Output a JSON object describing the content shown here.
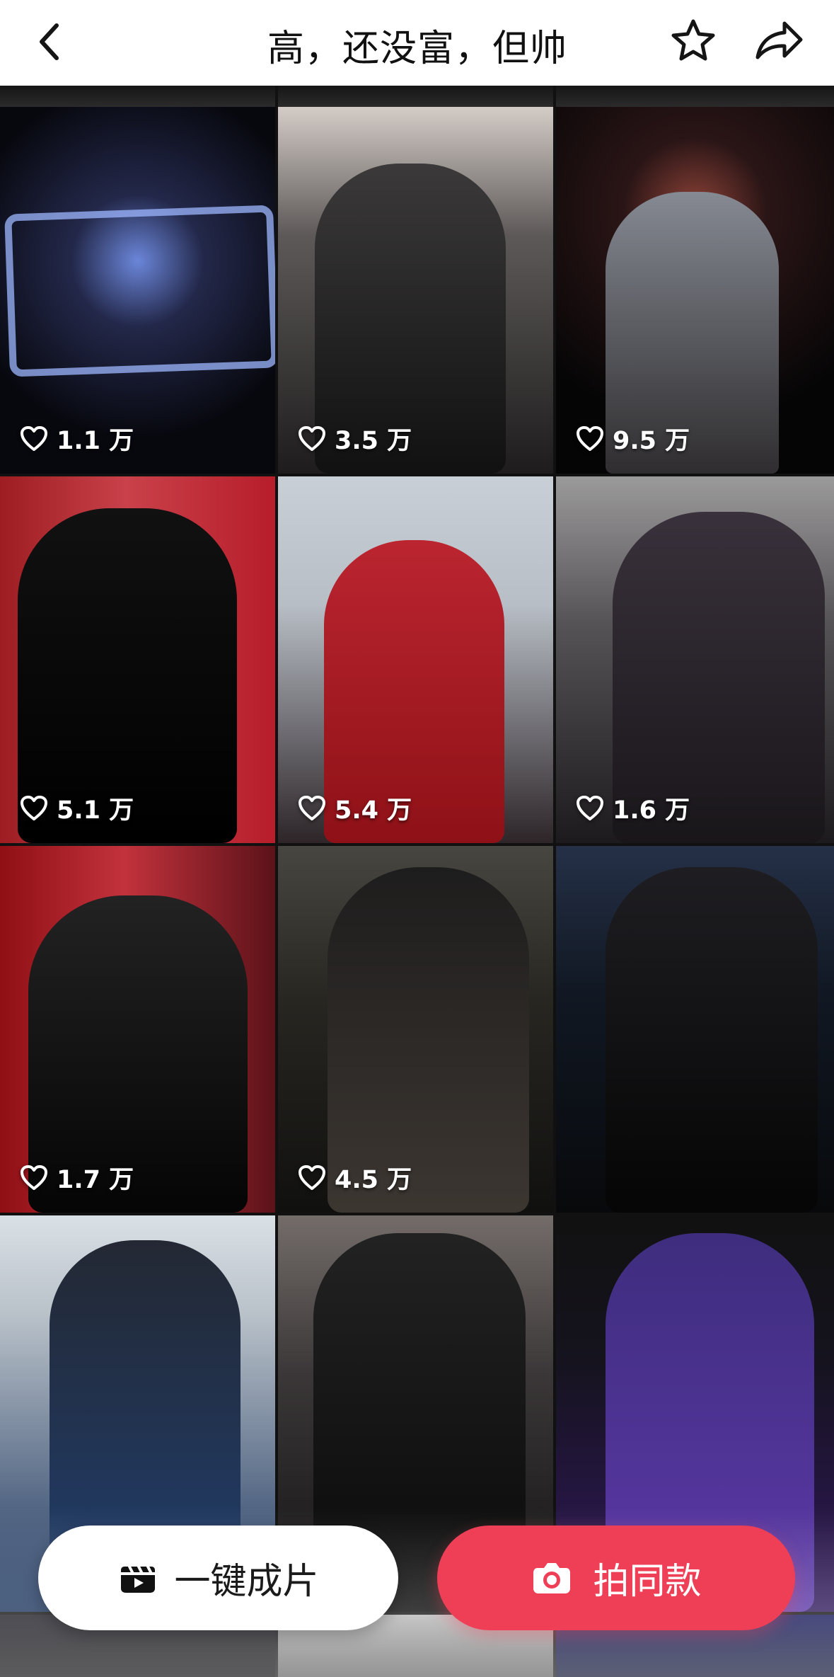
{
  "header": {
    "title": "高，还没富，但帅",
    "back_icon": "chevron-left-icon",
    "favorite_icon": "star-outline-icon",
    "share_icon": "share-arrow-icon"
  },
  "grid": {
    "tiles": [
      {
        "likes": "1.1 万"
      },
      {
        "likes": "3.5 万"
      },
      {
        "likes": "9.5 万"
      },
      {
        "likes": "5.1 万"
      },
      {
        "likes": "5.4 万"
      },
      {
        "likes": "1.6 万"
      },
      {
        "likes": "1.7 万"
      },
      {
        "likes": "4.5 万"
      },
      {
        "likes": ""
      },
      {
        "likes": ""
      },
      {
        "likes": ""
      },
      {
        "likes": ""
      }
    ]
  },
  "actions": {
    "one_click_label": "一键成片",
    "one_click_icon": "clapperboard-icon",
    "shoot_same_label": "拍同款",
    "shoot_same_icon": "camera-icon"
  },
  "colors": {
    "accent_red": "#ef3f56",
    "background": "#ffffff",
    "header_text": "#111111"
  }
}
